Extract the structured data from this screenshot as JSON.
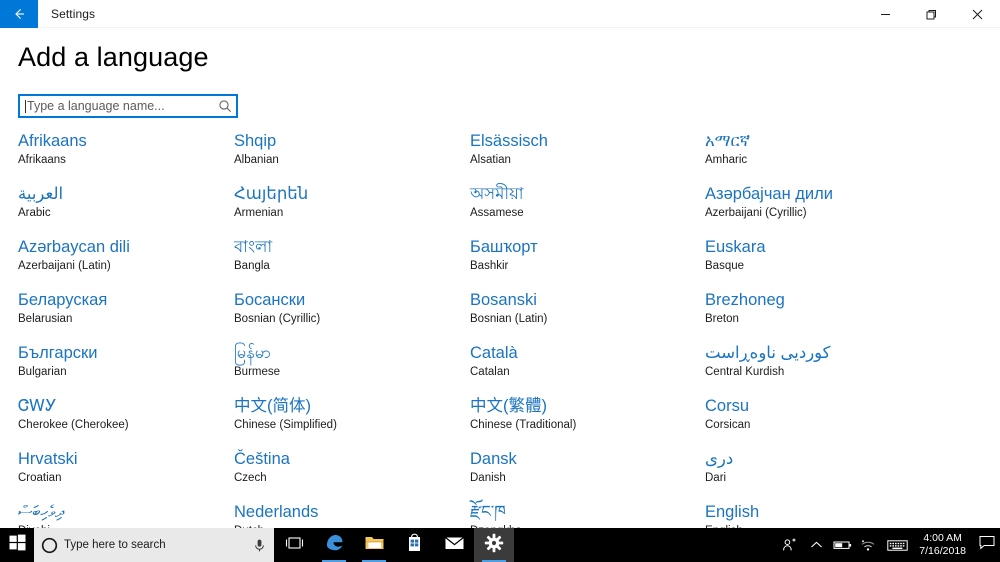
{
  "titlebar": {
    "app_name": "Settings",
    "back_icon": "back-arrow-icon",
    "minimize_label": "minimize-icon",
    "restore_label": "restore-icon",
    "close_label": "close-icon",
    "accent_color": "#0078d7"
  },
  "page": {
    "title": "Add a language"
  },
  "search": {
    "value": "",
    "placeholder": "Type a language name...",
    "icon": "search-icon"
  },
  "languages": [
    {
      "native": "Afrikaans",
      "english": "Afrikaans",
      "rtl": false
    },
    {
      "native": "Shqip",
      "english": "Albanian",
      "rtl": false
    },
    {
      "native": "Elsässisch",
      "english": "Alsatian",
      "rtl": false
    },
    {
      "native": "አማርኛ",
      "english": "Amharic",
      "rtl": false
    },
    {
      "native": "العربية",
      "english": "Arabic",
      "rtl": true
    },
    {
      "native": "Հայերեն",
      "english": "Armenian",
      "rtl": false
    },
    {
      "native": "অসমীয়া",
      "english": "Assamese",
      "rtl": false
    },
    {
      "native": "Азәрбајчан дили",
      "english": "Azerbaijani (Cyrillic)",
      "rtl": false
    },
    {
      "native": "Azərbaycan dili",
      "english": "Azerbaijani (Latin)",
      "rtl": false
    },
    {
      "native": "বাংলা",
      "english": "Bangla",
      "rtl": false
    },
    {
      "native": "Башҡорт",
      "english": "Bashkir",
      "rtl": false
    },
    {
      "native": "Euskara",
      "english": "Basque",
      "rtl": false
    },
    {
      "native": "Беларуская",
      "english": "Belarusian",
      "rtl": false
    },
    {
      "native": "Босански",
      "english": "Bosnian (Cyrillic)",
      "rtl": false
    },
    {
      "native": "Bosanski",
      "english": "Bosnian (Latin)",
      "rtl": false
    },
    {
      "native": "Brezhoneg",
      "english": "Breton",
      "rtl": false
    },
    {
      "native": "Български",
      "english": "Bulgarian",
      "rtl": false
    },
    {
      "native": "မြန်မာ",
      "english": "Burmese",
      "rtl": false
    },
    {
      "native": "Català",
      "english": "Catalan",
      "rtl": false
    },
    {
      "native": "کوردیی ناوەڕاست",
      "english": "Central Kurdish",
      "rtl": true
    },
    {
      "native": "ᏣᎳᎩ",
      "english": "Cherokee (Cherokee)",
      "rtl": false
    },
    {
      "native": "中文(简体)",
      "english": "Chinese (Simplified)",
      "rtl": false
    },
    {
      "native": "中文(繁體)",
      "english": "Chinese (Traditional)",
      "rtl": false
    },
    {
      "native": "Corsu",
      "english": "Corsican",
      "rtl": false
    },
    {
      "native": "Hrvatski",
      "english": "Croatian",
      "rtl": false
    },
    {
      "native": "Čeština",
      "english": "Czech",
      "rtl": false
    },
    {
      "native": "Dansk",
      "english": "Danish",
      "rtl": false
    },
    {
      "native": "دری",
      "english": "Dari",
      "rtl": true
    },
    {
      "native": "ދިވެހިބަސް",
      "english": "Divehi",
      "rtl": true
    },
    {
      "native": "Nederlands",
      "english": "Dutch",
      "rtl": false
    },
    {
      "native": "རྫོང་ཁ",
      "english": "Dzongkha",
      "rtl": false
    },
    {
      "native": "English",
      "english": "English",
      "rtl": false
    }
  ],
  "taskbar": {
    "start_icon": "windows-start-icon",
    "cortana_placeholder": "Type here to search",
    "cortana_circle_icon": "cortana-circle-icon",
    "mic_icon": "microphone-icon",
    "taskview_icon": "task-view-icon",
    "apps": [
      {
        "name": "edge",
        "icon": "edge-icon",
        "active": false,
        "running": true
      },
      {
        "name": "file-explorer",
        "icon": "file-explorer-icon",
        "active": false,
        "running": true
      },
      {
        "name": "microsoft-store",
        "icon": "microsoft-store-icon",
        "active": false,
        "running": false
      },
      {
        "name": "mail",
        "icon": "mail-icon",
        "active": false,
        "running": false
      },
      {
        "name": "settings",
        "icon": "gear-icon",
        "active": true,
        "running": true
      }
    ],
    "tray": {
      "people_icon": "people-icon",
      "show_hidden_icon": "chevron-up-icon",
      "battery_icon": "battery-icon",
      "network_icon": "wifi-icon",
      "keyboard_icon": "keyboard-icon",
      "time": "4:00 AM",
      "date": "7/16/2018",
      "action_center_icon": "action-center-icon"
    }
  }
}
